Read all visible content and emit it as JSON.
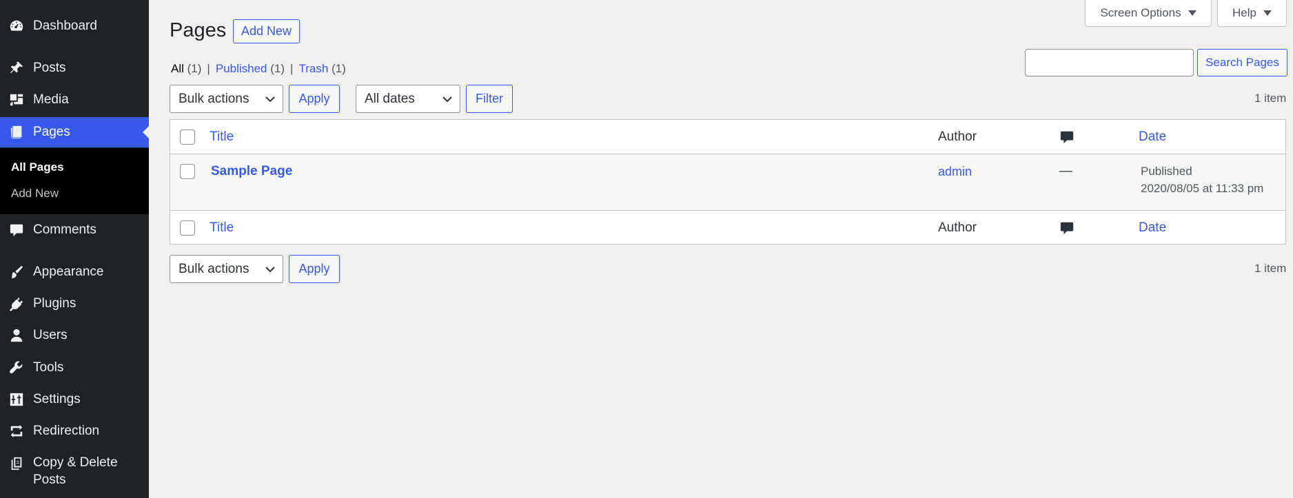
{
  "sidebar": {
    "items": [
      {
        "label": "Dashboard",
        "icon": "dashboard-icon"
      },
      {
        "label": "Posts",
        "icon": "pin-icon"
      },
      {
        "label": "Media",
        "icon": "media-icon"
      },
      {
        "label": "Pages",
        "icon": "pages-icon"
      },
      {
        "label": "Comments",
        "icon": "comment-icon"
      },
      {
        "label": "Appearance",
        "icon": "paintbrush-icon"
      },
      {
        "label": "Plugins",
        "icon": "plug-icon"
      },
      {
        "label": "Users",
        "icon": "user-icon"
      },
      {
        "label": "Tools",
        "icon": "wrench-icon"
      },
      {
        "label": "Settings",
        "icon": "sliders-icon"
      },
      {
        "label": "Redirection",
        "icon": "redirect-icon"
      },
      {
        "label_line1": "Copy & Delete",
        "label_line2": "Posts",
        "icon": "copy-icon"
      }
    ],
    "submenu": [
      {
        "label": "All Pages"
      },
      {
        "label": "Add New"
      }
    ]
  },
  "header": {
    "title": "Pages",
    "add_new": "Add New",
    "screen_options": "Screen Options",
    "help": "Help"
  },
  "filters": {
    "all_label": "All",
    "all_count": "(1)",
    "published_label": "Published",
    "published_count": "(1)",
    "trash_label": "Trash",
    "trash_count": "(1)",
    "separator": "|"
  },
  "search": {
    "value": "",
    "button": "Search Pages"
  },
  "tablenav": {
    "bulk_actions": "Bulk actions",
    "apply": "Apply",
    "all_dates": "All dates",
    "filter": "Filter",
    "item_count": "1 item"
  },
  "table": {
    "columns": {
      "title": "Title",
      "author": "Author",
      "date": "Date"
    },
    "rows": [
      {
        "title": "Sample Page",
        "author": "admin",
        "comments": "—",
        "status": "Published",
        "date": "2020/08/05 at 11:33 pm"
      }
    ]
  }
}
